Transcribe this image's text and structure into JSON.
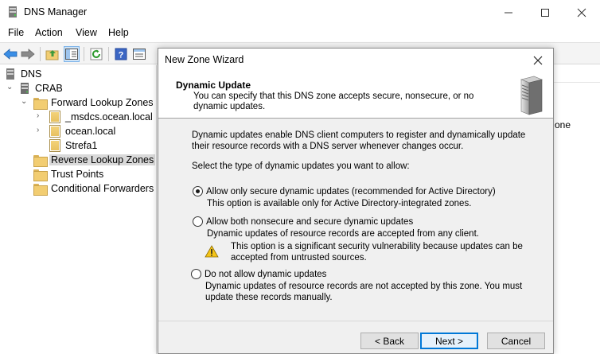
{
  "window": {
    "title": "DNS Manager"
  },
  "menu": [
    "File",
    "Action",
    "View",
    "Help"
  ],
  "tree": {
    "root": "DNS",
    "server": "CRAB",
    "forward": "Forward Lookup Zones",
    "zones": [
      "_msdcs.ocean.local",
      "ocean.local",
      "Strefa1"
    ],
    "reverse": "Reverse Lookup Zones",
    "trust": "Trust Points",
    "conditional": "Conditional Forwarders"
  },
  "right_pane": {
    "fragment": "one"
  },
  "dialog": {
    "title": "New Zone Wizard",
    "header_title": "Dynamic Update",
    "header_subtitle": "You can specify that this DNS zone accepts secure, nonsecure, or no dynamic updates.",
    "intro": "Dynamic updates enable DNS client computers to register and dynamically update their resource records with a DNS server whenever changes occur.",
    "prompt": "Select the type of dynamic updates you want to allow:",
    "options": [
      {
        "label": "Allow only secure dynamic updates (recommended for Active Directory)",
        "desc": "This option is available only for Active Directory-integrated zones.",
        "checked": true
      },
      {
        "label": "Allow both nonsecure and secure dynamic updates",
        "desc": "Dynamic updates of resource records are accepted from any client.",
        "warning": "This option is a significant security vulnerability because updates can be accepted from untrusted sources.",
        "checked": false
      },
      {
        "label": "Do not allow dynamic updates",
        "desc": "Dynamic updates of resource records are not accepted by this zone. You must update these records manually.",
        "checked": false
      }
    ],
    "buttons": {
      "back": "< Back",
      "next": "Next >",
      "cancel": "Cancel"
    }
  },
  "colors": {
    "accent": "#0078d7",
    "dialog_bg": "#f0f0f0",
    "selection": "#d9d9d9"
  },
  "icons": [
    "dns-app-icon",
    "minimize-icon",
    "maximize-icon",
    "close-icon",
    "back-arrow-icon",
    "forward-arrow-icon",
    "folder-up-icon",
    "show-hide-tree-icon",
    "refresh-icon",
    "help-icon",
    "export-list-icon",
    "server-icon",
    "folder-icon",
    "zone-icon",
    "warning-icon"
  ]
}
